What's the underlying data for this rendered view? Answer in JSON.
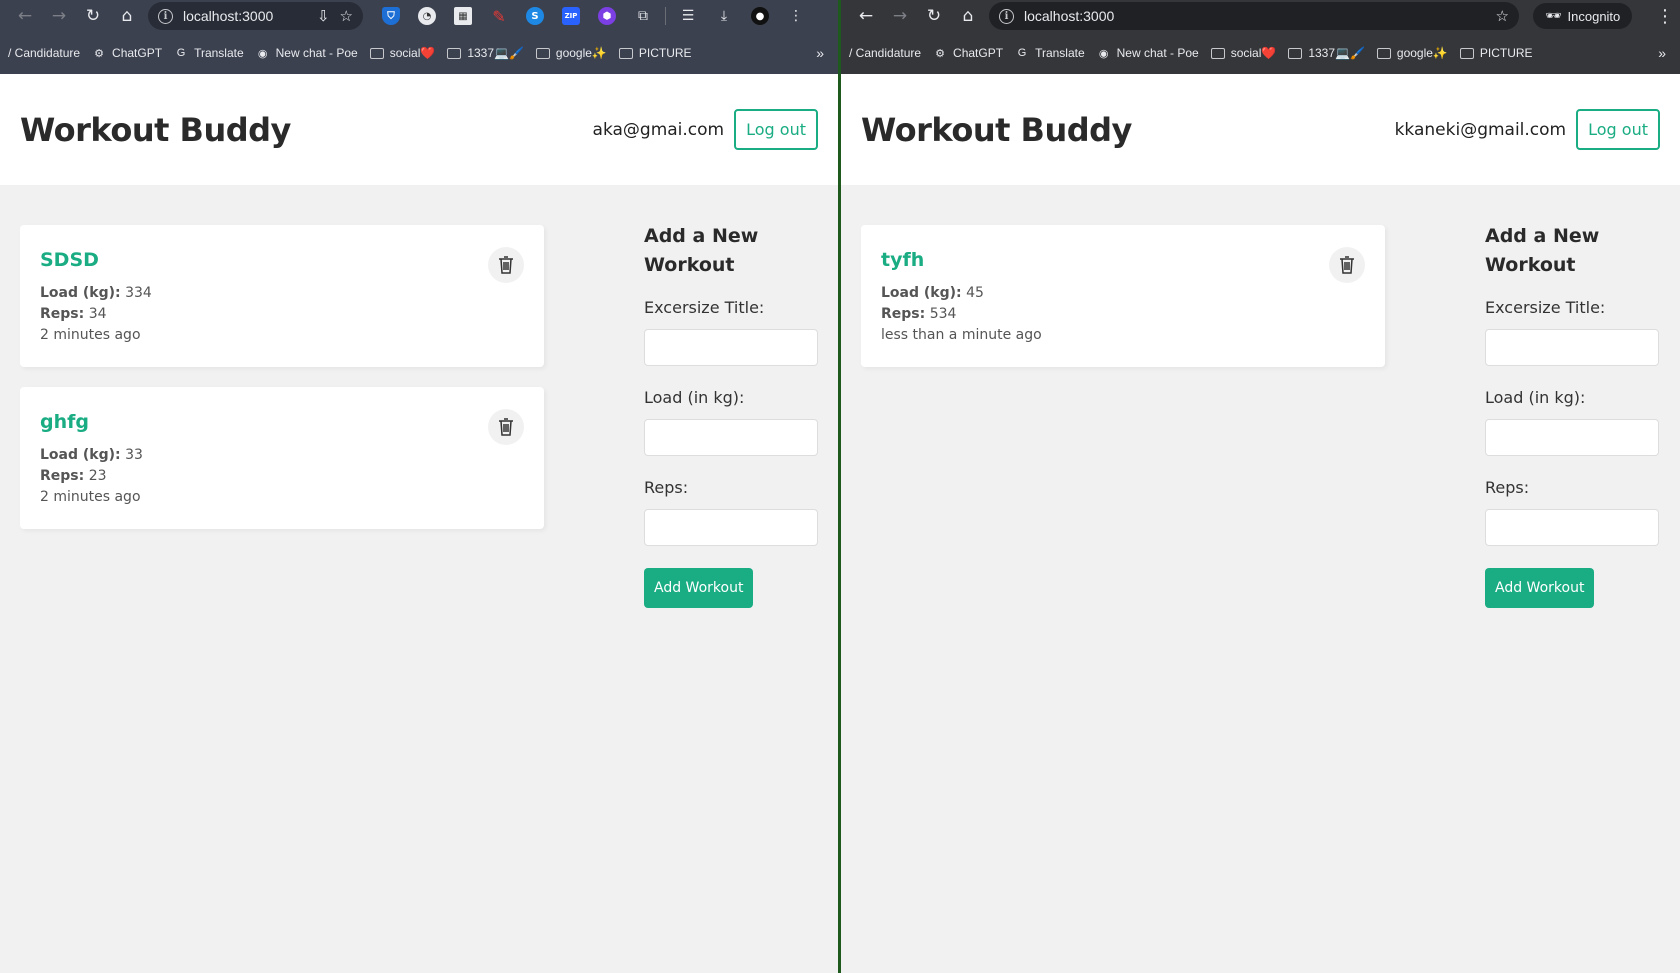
{
  "browser_a": {
    "url": "localhost:3000",
    "bookmarks": [
      "/ Candidature",
      "ChatGPT",
      "Translate",
      "New chat - Poe",
      "social❤️",
      "1337💻🖌️",
      "google✨",
      "PICTURE"
    ]
  },
  "browser_b": {
    "url": "localhost:3000",
    "incognito_label": "Incognito",
    "bookmarks": [
      "/ Candidature",
      "ChatGPT",
      "Translate",
      "New chat - Poe",
      "social❤️",
      "1337💻🖌️",
      "google✨",
      "PICTURE"
    ]
  },
  "app_a": {
    "brand": "Workout Buddy",
    "user_email": "aka@gmai.com",
    "logout_label": "Log out",
    "workouts": [
      {
        "title": "SDSD",
        "load_label": "Load (kg):",
        "load": "334",
        "reps_label": "Reps:",
        "reps": "34",
        "time": "2 minutes ago"
      },
      {
        "title": "ghfg",
        "load_label": "Load (kg):",
        "load": "33",
        "reps_label": "Reps:",
        "reps": "23",
        "time": "2 minutes ago"
      }
    ],
    "form": {
      "title_line1": "Add a New",
      "title_line2": "Workout",
      "label_title": "Excersize Title:",
      "label_load": "Load (in kg):",
      "label_reps": "Reps:",
      "button": "Add Workout"
    }
  },
  "app_b": {
    "brand": "Workout Buddy",
    "user_email": "kkaneki@gmail.com",
    "logout_label": "Log out",
    "workouts": [
      {
        "title": "tyfh",
        "load_label": "Load (kg):",
        "load": "45",
        "reps_label": "Reps:",
        "reps": "534",
        "time": "less than a minute ago"
      }
    ],
    "form": {
      "title_line1": "Add a New",
      "title_line2": "Workout",
      "label_title": "Excersize Title:",
      "label_load": "Load (in kg):",
      "label_reps": "Reps:",
      "button": "Add Workout"
    }
  },
  "colors": {
    "accent": "#1aac83",
    "page_bg": "#f1f1f1",
    "divider": "#1e5a1e"
  }
}
